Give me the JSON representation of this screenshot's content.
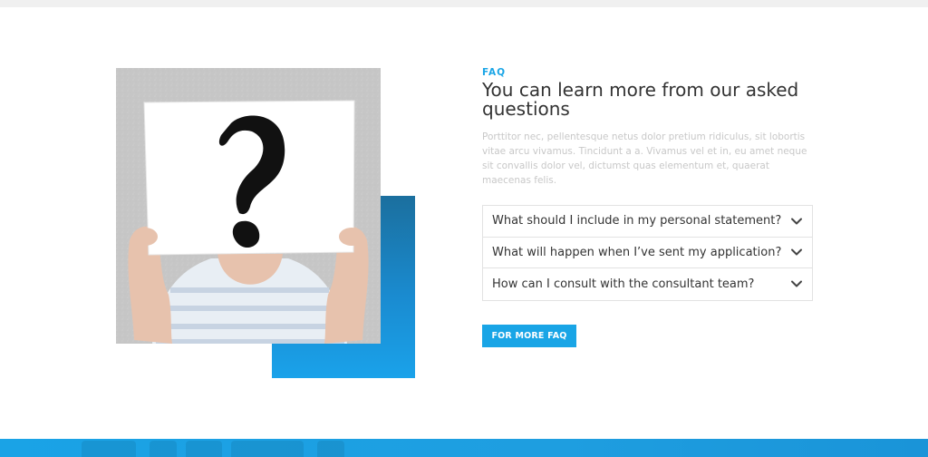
{
  "colors": {
    "accent": "#19a5e6",
    "heading": "#333333",
    "muted_text": "#c8c8c8",
    "blue_block_dark": "#1b6f9e",
    "blue_block_light": "#1aa2ea",
    "border": "#e2e2e2"
  },
  "faq": {
    "eyebrow": "FAQ",
    "heading": "You can learn more from our asked questions",
    "lead": "Porttitor nec, pellentesque netus dolor pretium ridiculus, sit lobortis vitae arcu vivamus. Tincidunt a a. Vivamus vel et in, eu amet neque sit convallis dolor vel, dictumst quas elementum et, quaerat maecenas felis.",
    "items": [
      {
        "question": "What should I include in my personal statement?",
        "icon": "chevron-down-icon"
      },
      {
        "question": "What will happen when I’ve sent my application?",
        "icon": "chevron-down-icon"
      },
      {
        "question": "How can I consult with the consultant team?",
        "icon": "chevron-down-icon"
      }
    ],
    "cta_label": "FOR MORE FAQ"
  },
  "image": {
    "subject": "person holding question mark sign"
  }
}
